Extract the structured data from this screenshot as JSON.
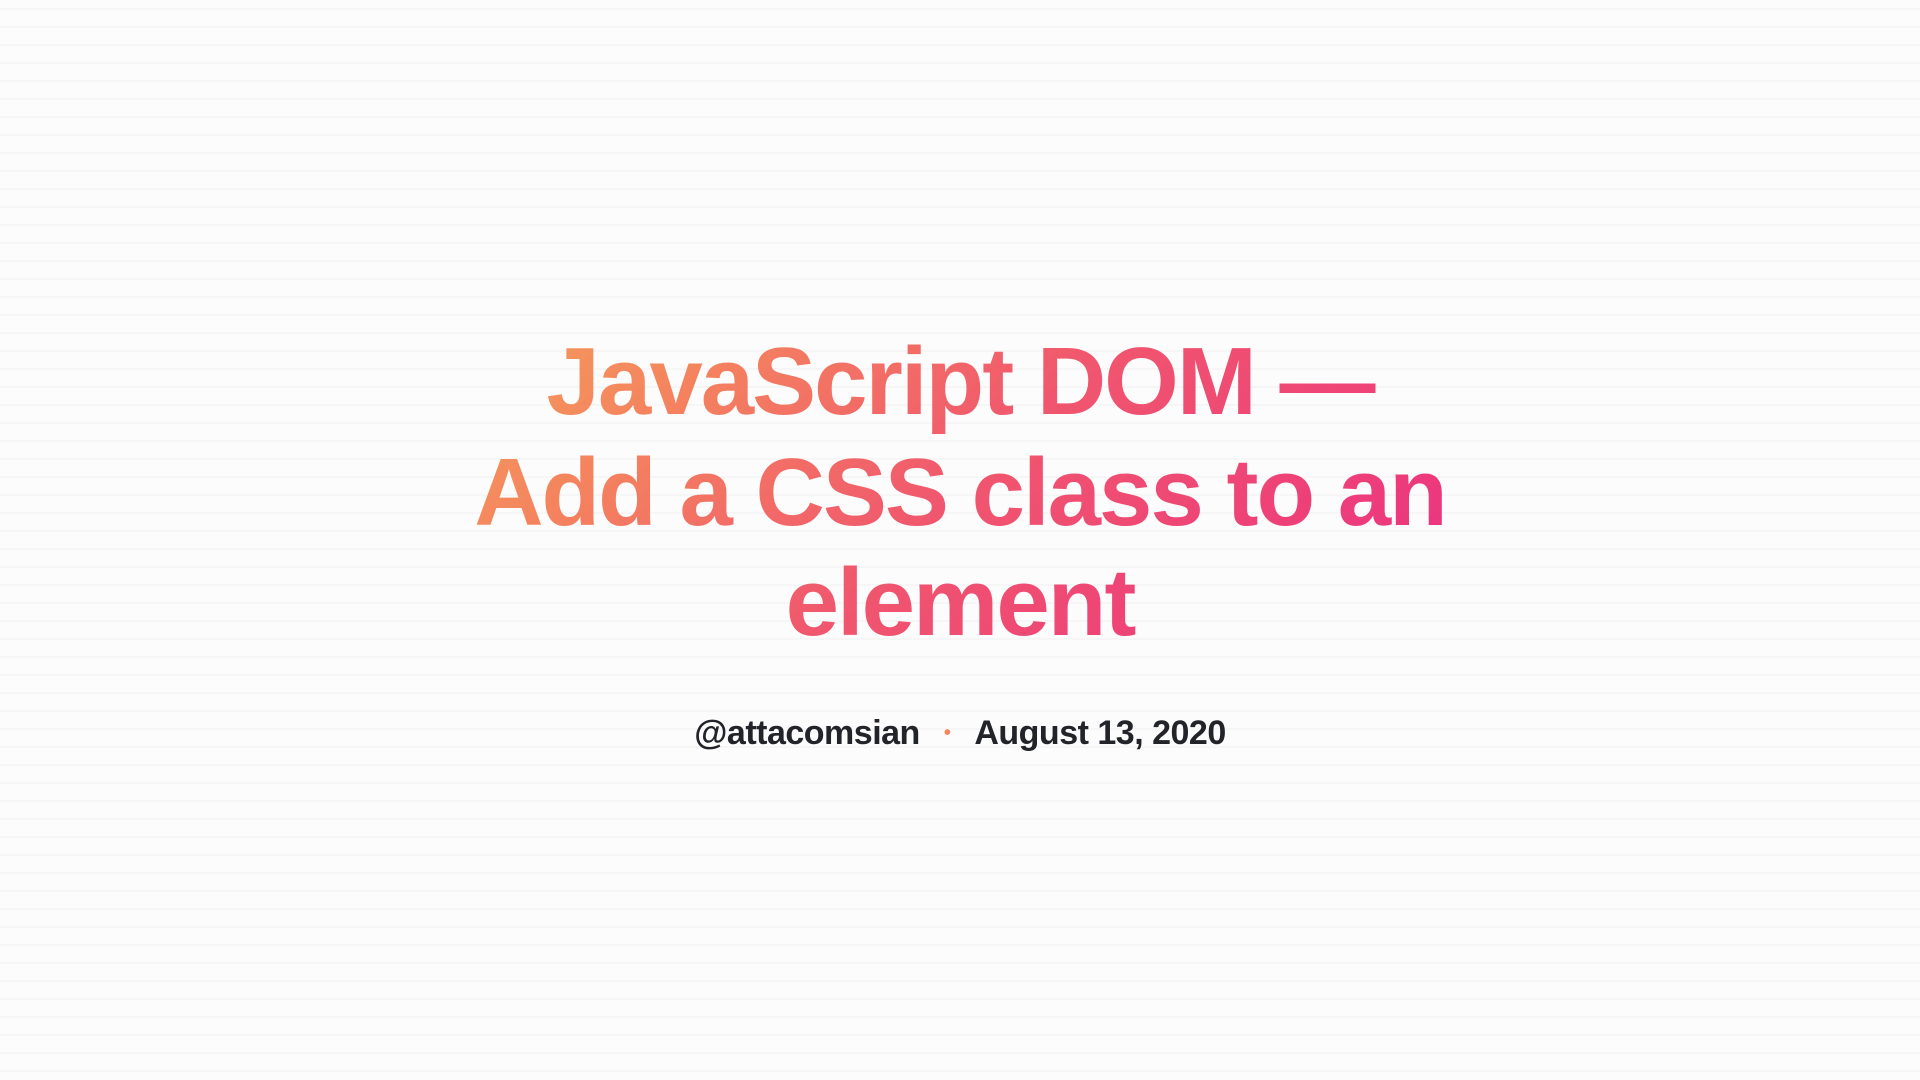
{
  "article": {
    "title": "JavaScript DOM — Add a CSS class to an element",
    "author_handle": "@attacomsian",
    "date": "August 13, 2020",
    "separator": "•"
  }
}
